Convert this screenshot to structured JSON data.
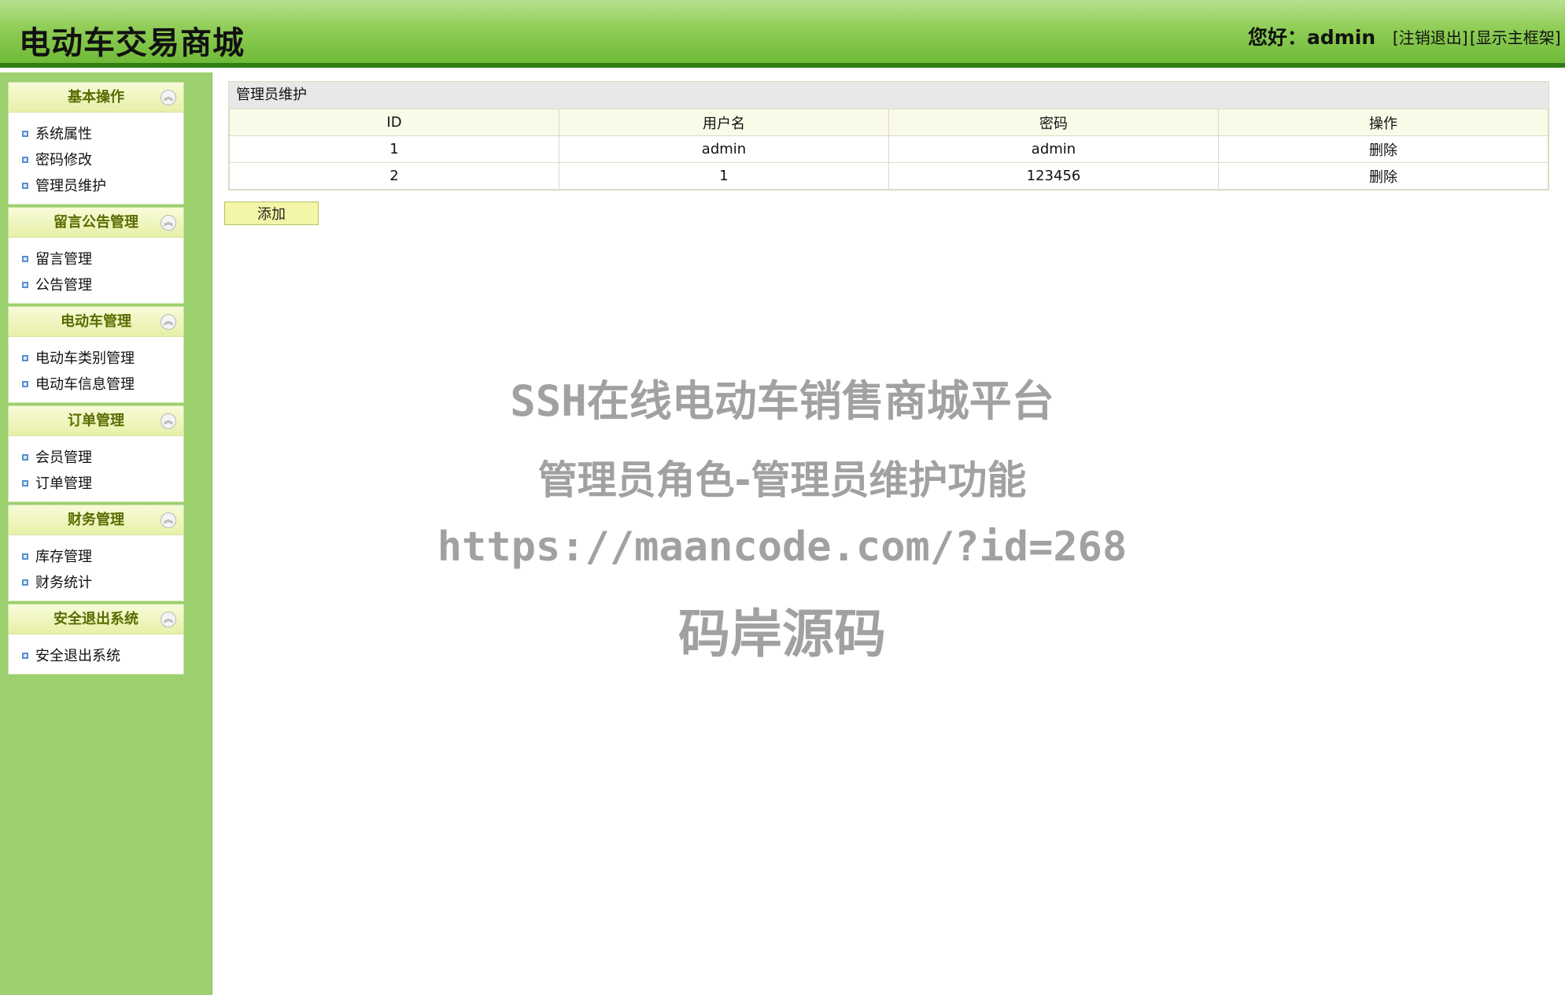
{
  "header": {
    "title": "电动车交易商城",
    "greeting": "您好：admin",
    "logout_link": "[注销退出]",
    "main_frame_link": "[显示主框架]"
  },
  "sidebar": {
    "sections": [
      {
        "title": "基本操作",
        "items": [
          "系统属性",
          "密码修改",
          "管理员维护"
        ]
      },
      {
        "title": "留言公告管理",
        "items": [
          "留言管理",
          "公告管理"
        ]
      },
      {
        "title": "电动车管理",
        "items": [
          "电动车类别管理",
          "电动车信息管理"
        ]
      },
      {
        "title": "订单管理",
        "items": [
          "会员管理",
          "订单管理"
        ]
      },
      {
        "title": "财务管理",
        "items": [
          "库存管理",
          "财务统计"
        ]
      },
      {
        "title": "安全退出系统",
        "items": [
          "安全退出系统"
        ]
      }
    ],
    "collapse_glyph": "︽"
  },
  "main": {
    "caption": "管理员维护",
    "columns": [
      "ID",
      "用户名",
      "密码",
      "操作"
    ],
    "rows": [
      {
        "id": "1",
        "username": "admin",
        "password": "admin",
        "action": "删除"
      },
      {
        "id": "2",
        "username": "1",
        "password": "123456",
        "action": "删除"
      }
    ],
    "add_button": "添加"
  },
  "watermark": {
    "line1": "SSH在线电动车销售商城平台",
    "line2": "管理员角色-管理员维护功能",
    "line3": "https://maancode.com/?id=268",
    "line4": "码岸源码"
  },
  "colors": {
    "header_green": "#8fcd56",
    "sidebar_green": "#9dd06e",
    "section_title": "#5a6b00",
    "add_button_bg": "#f3f5a8"
  }
}
